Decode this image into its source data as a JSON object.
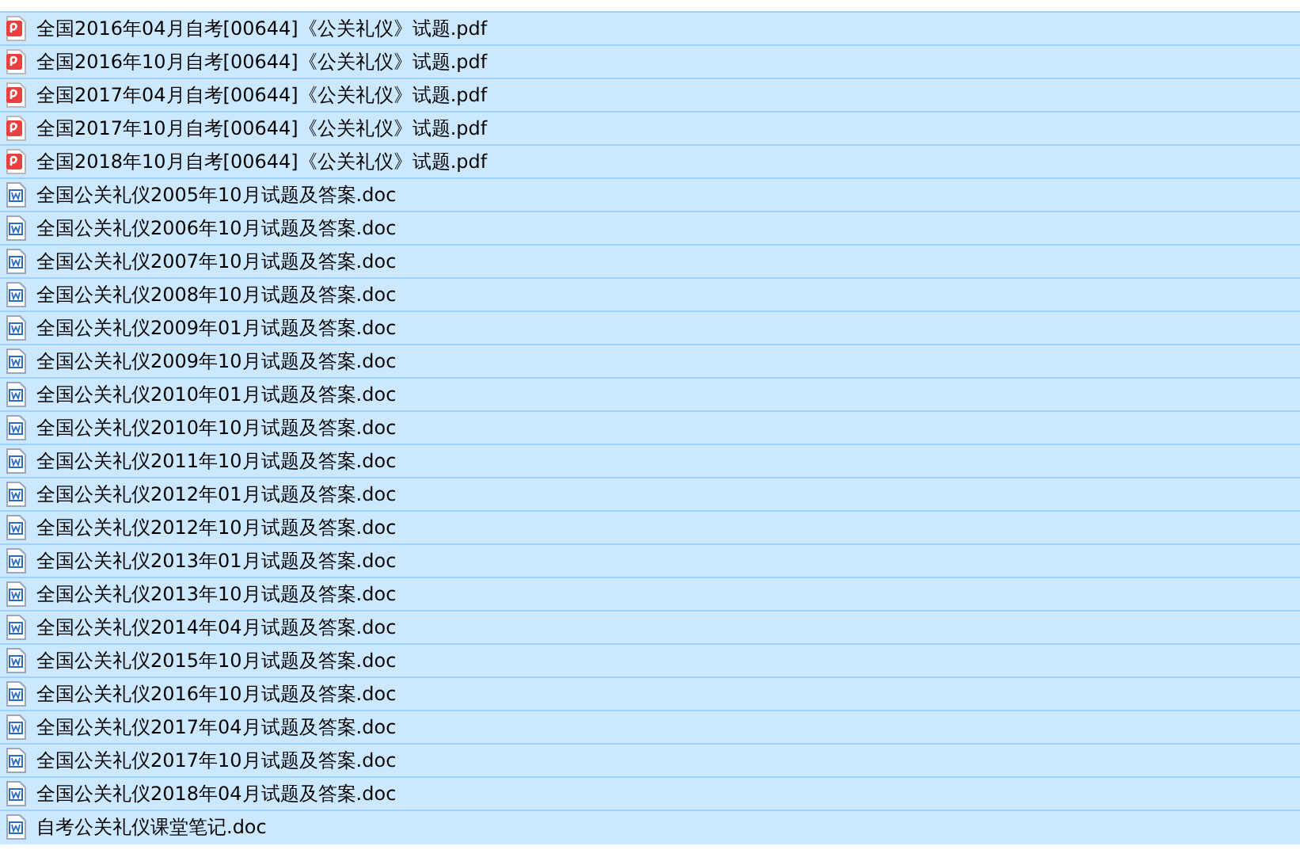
{
  "files": [
    {
      "name": "全国2016年04月自考[00644]《公关礼仪》试题.pdf",
      "kind": "pdf",
      "selected": true
    },
    {
      "name": "全国2016年10月自考[00644]《公关礼仪》试题.pdf",
      "kind": "pdf",
      "selected": true
    },
    {
      "name": "全国2017年04月自考[00644]《公关礼仪》试题.pdf",
      "kind": "pdf",
      "selected": true
    },
    {
      "name": "全国2017年10月自考[00644]《公关礼仪》试题.pdf",
      "kind": "pdf",
      "selected": true
    },
    {
      "name": "全国2018年10月自考[00644]《公关礼仪》试题.pdf",
      "kind": "pdf",
      "selected": true
    },
    {
      "name": "全国公关礼仪2005年10月试题及答案.doc",
      "kind": "doc",
      "selected": true
    },
    {
      "name": "全国公关礼仪2006年10月试题及答案.doc",
      "kind": "doc",
      "selected": true
    },
    {
      "name": "全国公关礼仪2007年10月试题及答案.doc",
      "kind": "doc",
      "selected": true
    },
    {
      "name": "全国公关礼仪2008年10月试题及答案.doc",
      "kind": "doc",
      "selected": true
    },
    {
      "name": "全国公关礼仪2009年01月试题及答案.doc",
      "kind": "doc",
      "selected": true
    },
    {
      "name": "全国公关礼仪2009年10月试题及答案.doc",
      "kind": "doc",
      "selected": true
    },
    {
      "name": "全国公关礼仪2010年01月试题及答案.doc",
      "kind": "doc",
      "selected": true
    },
    {
      "name": "全国公关礼仪2010年10月试题及答案.doc",
      "kind": "doc",
      "selected": true
    },
    {
      "name": "全国公关礼仪2011年10月试题及答案.doc",
      "kind": "doc",
      "selected": true
    },
    {
      "name": "全国公关礼仪2012年01月试题及答案.doc",
      "kind": "doc",
      "selected": true
    },
    {
      "name": "全国公关礼仪2012年10月试题及答案.doc",
      "kind": "doc",
      "selected": true
    },
    {
      "name": "全国公关礼仪2013年01月试题及答案.doc",
      "kind": "doc",
      "selected": true
    },
    {
      "name": "全国公关礼仪2013年10月试题及答案.doc",
      "kind": "doc",
      "selected": true
    },
    {
      "name": "全国公关礼仪2014年04月试题及答案.doc",
      "kind": "doc",
      "selected": true
    },
    {
      "name": "全国公关礼仪2015年10月试题及答案.doc",
      "kind": "doc",
      "selected": true
    },
    {
      "name": "全国公关礼仪2016年10月试题及答案.doc",
      "kind": "doc",
      "selected": true
    },
    {
      "name": "全国公关礼仪2017年04月试题及答案.doc",
      "kind": "doc",
      "selected": true
    },
    {
      "name": "全国公关礼仪2017年10月试题及答案.doc",
      "kind": "doc",
      "selected": true
    },
    {
      "name": "全国公关礼仪2018年04月试题及答案.doc",
      "kind": "doc",
      "selected": true
    },
    {
      "name": "自考公关礼仪课堂笔记.doc",
      "kind": "doc",
      "selected": true
    }
  ]
}
